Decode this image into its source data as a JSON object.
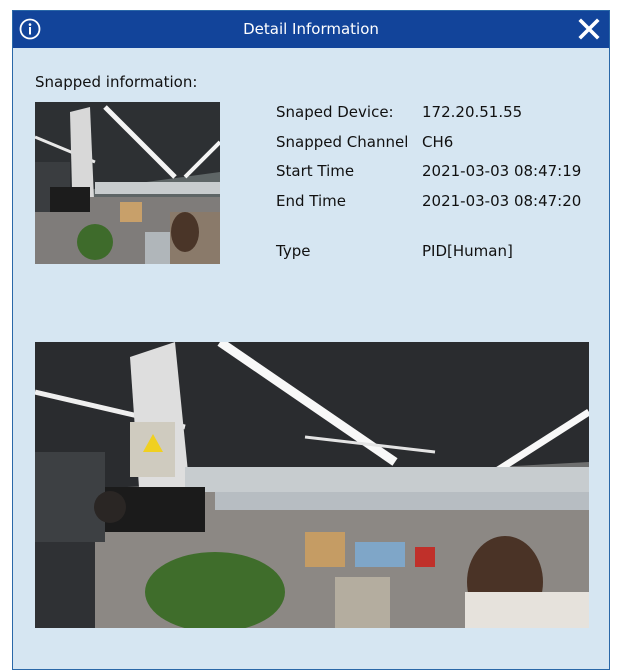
{
  "dialog": {
    "title": "Detail Information",
    "icons": {
      "info": "info-icon",
      "close": "close-icon"
    },
    "colors": {
      "titlebar": "#12449a",
      "body": "#d6e6f2",
      "border": "#2a68a8"
    }
  },
  "snapped": {
    "label": "Snapped information:",
    "fields": [
      {
        "key": "Snaped Device:",
        "value": "172.20.51.55"
      },
      {
        "key": "Snapped Channel",
        "value": "CH6"
      },
      {
        "key": "Start Time",
        "value": "2021-03-03 08:47:19"
      },
      {
        "key": "End Time",
        "value": "2021-03-03 08:47:20"
      }
    ],
    "type": {
      "key": "Type",
      "value": "PID[Human]"
    }
  }
}
